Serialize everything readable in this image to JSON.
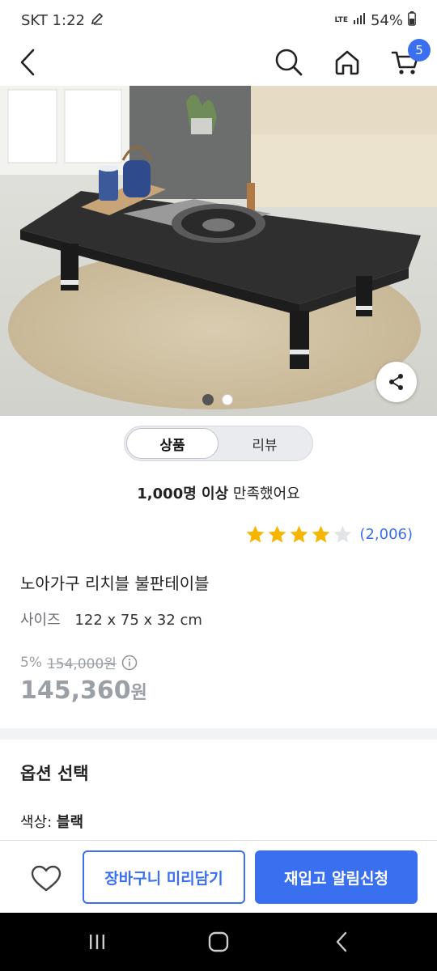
{
  "status": {
    "carrier_time": "SKT 1:22",
    "network": "LTE",
    "battery": "54%"
  },
  "nav": {
    "cart_count": "5",
    "icons": [
      "back-icon",
      "search-icon",
      "home-icon",
      "cart-icon"
    ]
  },
  "gallery": {
    "current_index": 0,
    "total": 2
  },
  "tabs": [
    {
      "label": "상품",
      "active": true
    },
    {
      "label": "리뷰",
      "active": false
    }
  ],
  "satisfaction": {
    "bold": "1,000명 이상",
    "rest": " 만족했어요"
  },
  "rating": {
    "stars": 4,
    "max": 5,
    "count": "(2,006)",
    "star_color": "#f7b500"
  },
  "product": {
    "title": "노아가구 리치블 불판테이블",
    "size_label": "사이즈",
    "size_value": "122 x 75 x 32 cm",
    "discount": "5%",
    "original_price": "154,000원",
    "final_price": "145,360",
    "final_currency": "원"
  },
  "options": {
    "heading": "옵션 선택",
    "color_label": "색상: ",
    "color_value": "블랙"
  },
  "actions": {
    "cart_preview": "장바구니 미리담기",
    "restock_alert": "재입고 알림신청",
    "accent": "#3a6ff0"
  }
}
